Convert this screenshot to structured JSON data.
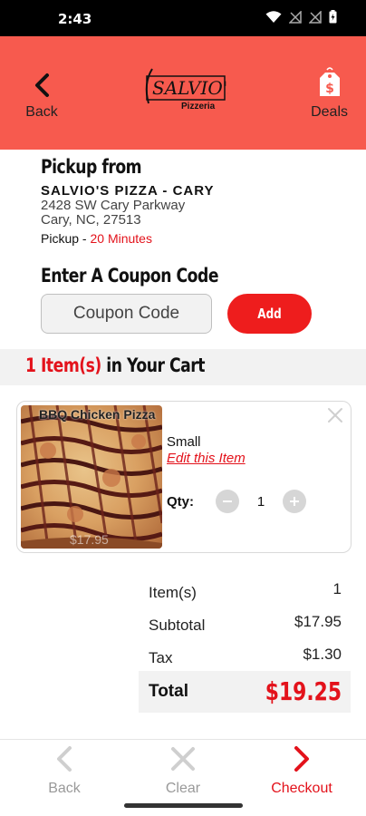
{
  "status_bar": {
    "time": "2:43"
  },
  "header": {
    "back_label": "Back",
    "deals_label": "Deals",
    "logo_text": "SALVIO'S",
    "logo_subtext": "Pizzeria",
    "color": "#f75a4e"
  },
  "pickup": {
    "title": "Pickup from",
    "store_name": "SALVIO'S PIZZA - CARY",
    "address_line1": "2428 SW Cary Parkway",
    "address_line2": "Cary, NC, 27513",
    "pickup_label": "Pickup",
    "pickup_separator": " - ",
    "pickup_time": "20 Minutes"
  },
  "coupon": {
    "title": "Enter A Coupon Code",
    "placeholder": "Coupon Code",
    "add_label": "Add"
  },
  "cart": {
    "count_text": "1 Item(s)",
    "title_rest": " in Your Cart",
    "items": [
      {
        "name": "BBQ Chicken Pizza",
        "price_overlay": "$17.95",
        "size": "Small",
        "edit_label": "Edit this Item",
        "qty_label": "Qty:",
        "quantity": "1"
      }
    ]
  },
  "totals": {
    "items_label": "Item(s)",
    "items_value": "1",
    "subtotal_label": "Subtotal",
    "subtotal_value": "$17.95",
    "tax_label": "Tax",
    "tax_value": "$1.30",
    "total_label": "Total",
    "total_value": "$19.25"
  },
  "bottom_nav": {
    "back_label": "Back",
    "clear_label": "Clear",
    "checkout_label": "Checkout"
  },
  "colors": {
    "accent_red": "#e3121b",
    "button_red": "#ee1d1d",
    "header_coral": "#f75a4e"
  },
  "icons": [
    "wifi-icon",
    "signal-icon",
    "signal-icon-2",
    "battery-icon",
    "back-chevron-icon",
    "price-tag-icon",
    "close-icon",
    "minus-icon",
    "plus-icon",
    "clear-x-icon",
    "checkout-chevron-icon"
  ]
}
